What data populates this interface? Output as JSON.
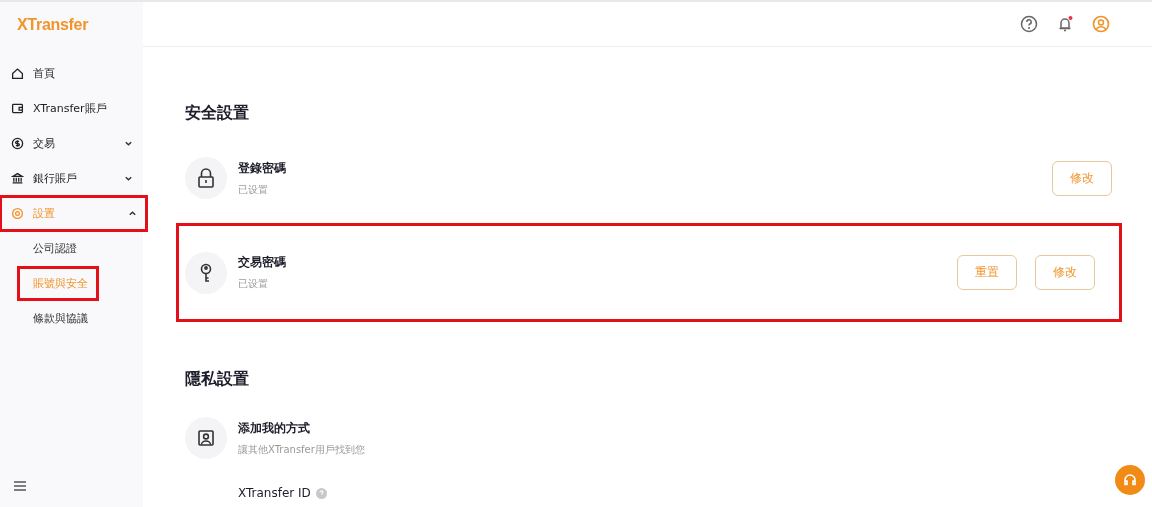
{
  "logo": "XTransfer",
  "nav": [
    {
      "label": "首頁",
      "kind": "home",
      "selected": false,
      "highlighted": false
    },
    {
      "label": "XTransfer賬戶",
      "kind": "wallet",
      "selected": false,
      "highlighted": false
    },
    {
      "label": "交易",
      "kind": "dollar",
      "selected": false,
      "expanded": false,
      "highlighted": false
    },
    {
      "label": "銀行賬戶",
      "kind": "bank",
      "selected": false,
      "expanded": false,
      "highlighted": false
    },
    {
      "label": "設置",
      "kind": "gear",
      "selected": true,
      "expanded": true,
      "highlighted": true,
      "children": [
        {
          "label": "公司認證",
          "selected": false,
          "highlighted": false
        },
        {
          "label": "賬號與安全",
          "selected": true,
          "highlighted": true
        },
        {
          "label": "條款與協議",
          "selected": false,
          "highlighted": false
        }
      ]
    }
  ],
  "notifications": {
    "unread": true
  },
  "sections": [
    {
      "title": "安全設置",
      "items": [
        {
          "kind": "lock",
          "title": "登錄密碼",
          "status": "已设置",
          "highlighted": false,
          "buttons": [
            "修改"
          ]
        },
        {
          "kind": "key",
          "title": "交易密碼",
          "status": "已设置",
          "highlighted": true,
          "buttons": [
            "重置",
            "修改"
          ]
        }
      ]
    },
    {
      "title": "隱私設置",
      "items": [
        {
          "kind": "contact",
          "title": "添加我的方式",
          "status": "讓其他XTransfer用戶找到您",
          "highlighted": false
        }
      ]
    }
  ],
  "id_label": "XTransfer ID"
}
